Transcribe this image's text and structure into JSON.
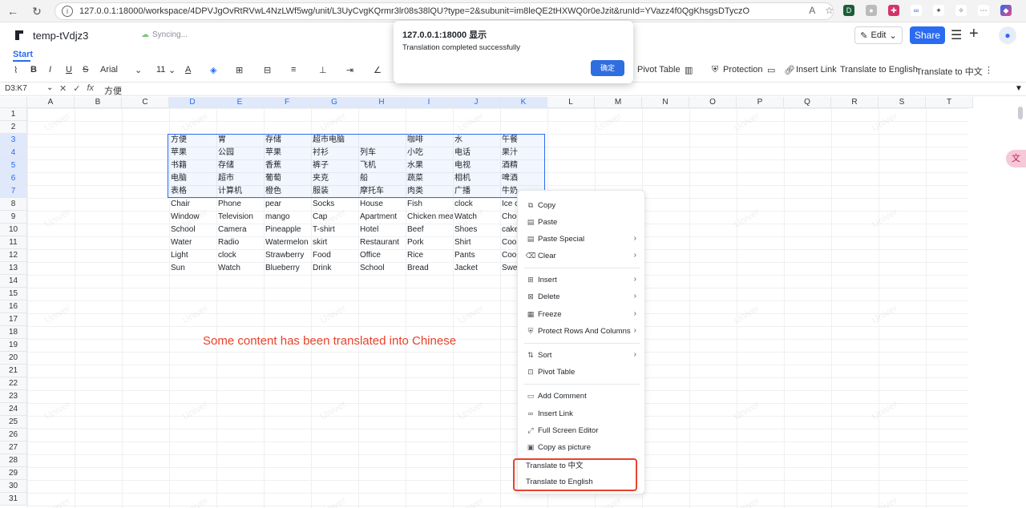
{
  "browser": {
    "url": "127.0.0.1:18000/workspace/4DPVJgOvRtRVwL4NzLWf5wg/unit/L3UyCvgKQrmr3lr08s38lQU?type=2&subunit=im8leQE2tHXWQ0r0eJzit&runId=YVazz4f0QgKhsgsDTyczO"
  },
  "header": {
    "doc_title": "temp-tVdjz3",
    "sync_status": "Syncing...",
    "edit_label": "Edit",
    "share_label": "Share"
  },
  "tabs": {
    "start": "Start"
  },
  "toolbar": {
    "font": "Arial",
    "size": "11",
    "pivot_table": "Pivot Table",
    "protection": "Protection",
    "insert_link": "Insert Link",
    "translate_en": "Translate to English",
    "translate_zh": "Translate to 中文"
  },
  "formula": {
    "cell_ref": "D3:K7",
    "value": "方便"
  },
  "columns": [
    "A",
    "B",
    "C",
    "D",
    "E",
    "F",
    "G",
    "H",
    "I",
    "J",
    "K",
    "L",
    "M",
    "N",
    "O",
    "P",
    "Q",
    "R",
    "S",
    "T"
  ],
  "rows": [
    "1",
    "2",
    "3",
    "4",
    "5",
    "6",
    "7",
    "8",
    "9",
    "10",
    "11",
    "12",
    "13",
    "14",
    "15",
    "16",
    "17",
    "18",
    "19",
    "20",
    "21",
    "22",
    "23",
    "24",
    "25",
    "26",
    "27",
    "28",
    "29",
    "30",
    "31"
  ],
  "cells": {
    "r3": [
      "方便",
      "胃",
      "存储",
      "超市电脑",
      "",
      "咖啡",
      "水",
      "午餐"
    ],
    "r4": [
      "苹果",
      "公园",
      "苹果",
      "衬衫",
      "列车",
      "小吃",
      "电话",
      "果汁"
    ],
    "r5": [
      "书籍",
      "存储",
      "香蕉",
      "裤子",
      "飞机",
      "水果",
      "电视",
      "酒精"
    ],
    "r6": [
      "电脑",
      "超市",
      "葡萄",
      "夹克",
      "船",
      "蔬菜",
      "相机",
      "啤酒"
    ],
    "r7": [
      "表格",
      "计算机",
      "橙色",
      "服装",
      "摩托车",
      "肉类",
      "广播",
      "牛奶"
    ],
    "r8": [
      "Chair",
      "Phone",
      "pear",
      "Socks",
      "House",
      "Fish",
      "clock",
      "Ice cr"
    ],
    "r9": [
      "Window",
      "Television",
      "mango",
      "Cap",
      "Apartment",
      "Chicken mea",
      "Watch",
      "Choc"
    ],
    "r10": [
      "School",
      "Camera",
      "Pineapple",
      "T-shirt",
      "Hotel",
      "Beef",
      "Shoes",
      "cake"
    ],
    "r11": [
      "Water",
      "Radio",
      "Watermelon",
      "skirt",
      "Restaurant",
      "Pork",
      "Shirt",
      "Cook"
    ],
    "r12": [
      "Light",
      "clock",
      "Strawberry",
      "Food",
      "Office",
      "Rice",
      "Pants",
      "Cook"
    ],
    "r13": [
      "Sun",
      "Watch",
      "Blueberry",
      "Drink",
      "School",
      "Bread",
      "Jacket",
      "Swee"
    ]
  },
  "watermark": "Univer",
  "annotation": "Some content has been translated into Chinese",
  "dialog": {
    "title": "127.0.0.1:18000 显示",
    "message": "Translation completed successfully",
    "ok": "确定"
  },
  "context_menu": {
    "copy": "Copy",
    "paste": "Paste",
    "paste_special": "Paste Special",
    "clear": "Clear",
    "insert": "Insert",
    "delete": "Delete",
    "freeze": "Freeze",
    "protect": "Protect Rows And Columns",
    "sort": "Sort",
    "pivot": "Pivot Table",
    "add_comment": "Add Comment",
    "insert_link": "Insert Link",
    "full_screen": "Full Screen Editor",
    "copy_picture": "Copy as picture",
    "translate_zh": "Translate to 中文",
    "translate_en": "Translate to English"
  }
}
